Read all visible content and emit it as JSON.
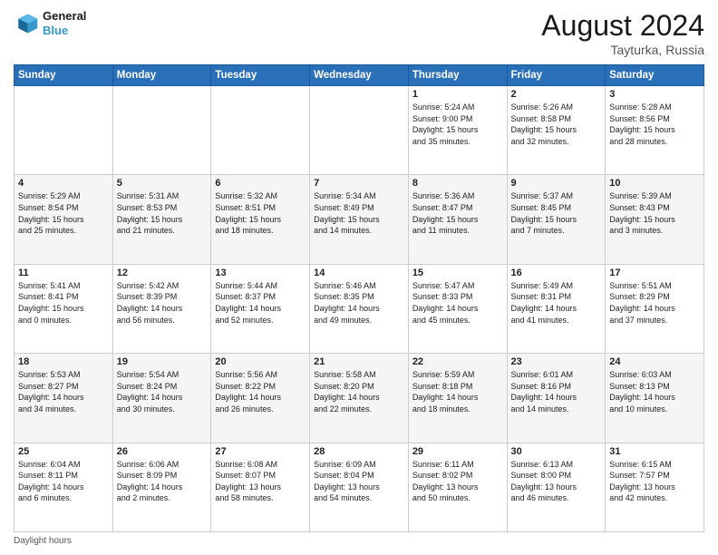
{
  "header": {
    "logo_line1": "General",
    "logo_line2": "Blue",
    "month_title": "August 2024",
    "location": "Tayturka, Russia"
  },
  "weekdays": [
    "Sunday",
    "Monday",
    "Tuesday",
    "Wednesday",
    "Thursday",
    "Friday",
    "Saturday"
  ],
  "footer": {
    "daylight_label": "Daylight hours"
  },
  "weeks": [
    [
      {
        "day": "",
        "info": ""
      },
      {
        "day": "",
        "info": ""
      },
      {
        "day": "",
        "info": ""
      },
      {
        "day": "",
        "info": ""
      },
      {
        "day": "1",
        "info": "Sunrise: 5:24 AM\nSunset: 9:00 PM\nDaylight: 15 hours\nand 35 minutes."
      },
      {
        "day": "2",
        "info": "Sunrise: 5:26 AM\nSunset: 8:58 PM\nDaylight: 15 hours\nand 32 minutes."
      },
      {
        "day": "3",
        "info": "Sunrise: 5:28 AM\nSunset: 8:56 PM\nDaylight: 15 hours\nand 28 minutes."
      }
    ],
    [
      {
        "day": "4",
        "info": "Sunrise: 5:29 AM\nSunset: 8:54 PM\nDaylight: 15 hours\nand 25 minutes."
      },
      {
        "day": "5",
        "info": "Sunrise: 5:31 AM\nSunset: 8:53 PM\nDaylight: 15 hours\nand 21 minutes."
      },
      {
        "day": "6",
        "info": "Sunrise: 5:32 AM\nSunset: 8:51 PM\nDaylight: 15 hours\nand 18 minutes."
      },
      {
        "day": "7",
        "info": "Sunrise: 5:34 AM\nSunset: 8:49 PM\nDaylight: 15 hours\nand 14 minutes."
      },
      {
        "day": "8",
        "info": "Sunrise: 5:36 AM\nSunset: 8:47 PM\nDaylight: 15 hours\nand 11 minutes."
      },
      {
        "day": "9",
        "info": "Sunrise: 5:37 AM\nSunset: 8:45 PM\nDaylight: 15 hours\nand 7 minutes."
      },
      {
        "day": "10",
        "info": "Sunrise: 5:39 AM\nSunset: 8:43 PM\nDaylight: 15 hours\nand 3 minutes."
      }
    ],
    [
      {
        "day": "11",
        "info": "Sunrise: 5:41 AM\nSunset: 8:41 PM\nDaylight: 15 hours\nand 0 minutes."
      },
      {
        "day": "12",
        "info": "Sunrise: 5:42 AM\nSunset: 8:39 PM\nDaylight: 14 hours\nand 56 minutes."
      },
      {
        "day": "13",
        "info": "Sunrise: 5:44 AM\nSunset: 8:37 PM\nDaylight: 14 hours\nand 52 minutes."
      },
      {
        "day": "14",
        "info": "Sunrise: 5:46 AM\nSunset: 8:35 PM\nDaylight: 14 hours\nand 49 minutes."
      },
      {
        "day": "15",
        "info": "Sunrise: 5:47 AM\nSunset: 8:33 PM\nDaylight: 14 hours\nand 45 minutes."
      },
      {
        "day": "16",
        "info": "Sunrise: 5:49 AM\nSunset: 8:31 PM\nDaylight: 14 hours\nand 41 minutes."
      },
      {
        "day": "17",
        "info": "Sunrise: 5:51 AM\nSunset: 8:29 PM\nDaylight: 14 hours\nand 37 minutes."
      }
    ],
    [
      {
        "day": "18",
        "info": "Sunrise: 5:53 AM\nSunset: 8:27 PM\nDaylight: 14 hours\nand 34 minutes."
      },
      {
        "day": "19",
        "info": "Sunrise: 5:54 AM\nSunset: 8:24 PM\nDaylight: 14 hours\nand 30 minutes."
      },
      {
        "day": "20",
        "info": "Sunrise: 5:56 AM\nSunset: 8:22 PM\nDaylight: 14 hours\nand 26 minutes."
      },
      {
        "day": "21",
        "info": "Sunrise: 5:58 AM\nSunset: 8:20 PM\nDaylight: 14 hours\nand 22 minutes."
      },
      {
        "day": "22",
        "info": "Sunrise: 5:59 AM\nSunset: 8:18 PM\nDaylight: 14 hours\nand 18 minutes."
      },
      {
        "day": "23",
        "info": "Sunrise: 6:01 AM\nSunset: 8:16 PM\nDaylight: 14 hours\nand 14 minutes."
      },
      {
        "day": "24",
        "info": "Sunrise: 6:03 AM\nSunset: 8:13 PM\nDaylight: 14 hours\nand 10 minutes."
      }
    ],
    [
      {
        "day": "25",
        "info": "Sunrise: 6:04 AM\nSunset: 8:11 PM\nDaylight: 14 hours\nand 6 minutes."
      },
      {
        "day": "26",
        "info": "Sunrise: 6:06 AM\nSunset: 8:09 PM\nDaylight: 14 hours\nand 2 minutes."
      },
      {
        "day": "27",
        "info": "Sunrise: 6:08 AM\nSunset: 8:07 PM\nDaylight: 13 hours\nand 58 minutes."
      },
      {
        "day": "28",
        "info": "Sunrise: 6:09 AM\nSunset: 8:04 PM\nDaylight: 13 hours\nand 54 minutes."
      },
      {
        "day": "29",
        "info": "Sunrise: 6:11 AM\nSunset: 8:02 PM\nDaylight: 13 hours\nand 50 minutes."
      },
      {
        "day": "30",
        "info": "Sunrise: 6:13 AM\nSunset: 8:00 PM\nDaylight: 13 hours\nand 46 minutes."
      },
      {
        "day": "31",
        "info": "Sunrise: 6:15 AM\nSunset: 7:57 PM\nDaylight: 13 hours\nand 42 minutes."
      }
    ]
  ]
}
